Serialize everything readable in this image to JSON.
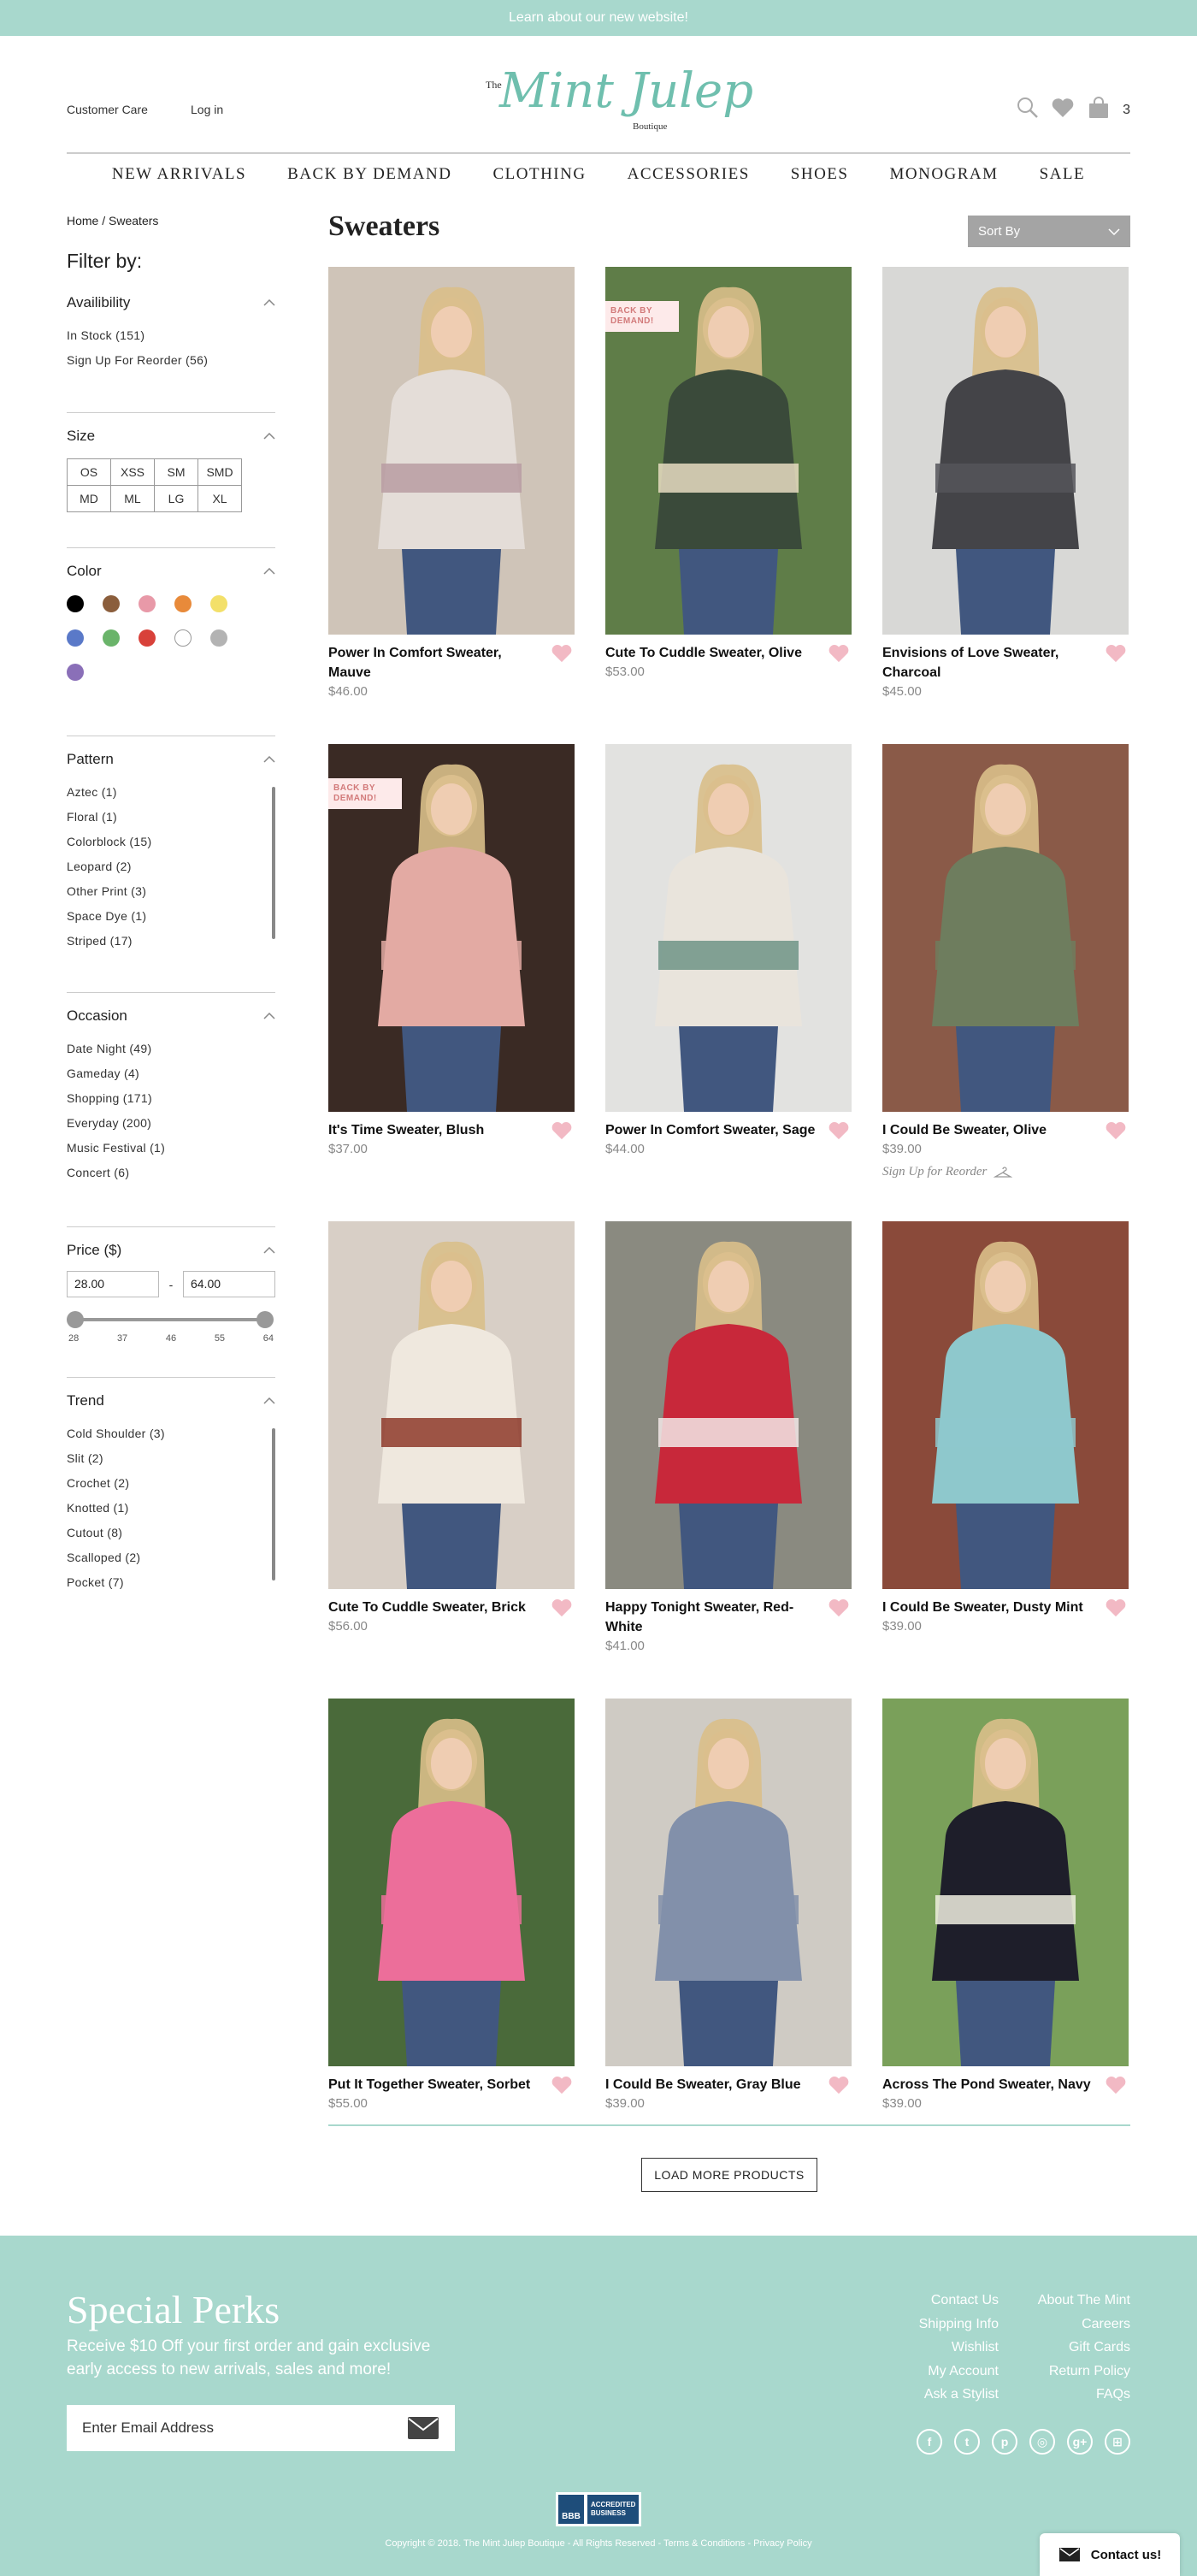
{
  "topbar": {
    "text": "Learn about our new website!"
  },
  "header": {
    "customer_care": "Customer Care",
    "login": "Log in",
    "logo": {
      "the": "The",
      "name": "Mint Julep",
      "boutique": "Boutique"
    },
    "cart_count": "3",
    "icons": [
      "search-icon",
      "heart-icon",
      "bag-icon"
    ]
  },
  "nav": [
    "NEW ARRIVALS",
    "BACK BY DEMAND",
    "CLOTHING",
    "ACCESSORIES",
    "SHOES",
    "MONOGRAM",
    "SALE"
  ],
  "breadcrumb": {
    "home": "Home",
    "sep": "/",
    "current": "Sweaters"
  },
  "filters": {
    "title": "Filter by:",
    "availability": {
      "label": "Availibility",
      "options": [
        "In Stock (151)",
        "Sign Up For Reorder (56)"
      ]
    },
    "size": {
      "label": "Size",
      "options": [
        "OS",
        "XSS",
        "SM",
        "SMD",
        "MD",
        "ML",
        "LG",
        "XL"
      ]
    },
    "color": {
      "label": "Color",
      "swatches": [
        "#000000",
        "#8b5e3c",
        "#e899a8",
        "#e88a3a",
        "#f3e06a",
        "#5a79c8",
        "#6ab46a",
        "#d8413a",
        "#ffffff",
        "#b3b3b3",
        "#8a6fb8"
      ]
    },
    "pattern": {
      "label": "Pattern",
      "options": [
        "Aztec (1)",
        "Floral (1)",
        "Colorblock (15)",
        "Leopard (2)",
        "Other Print (3)",
        "Space Dye (1)",
        "Striped (17)"
      ]
    },
    "occasion": {
      "label": "Occasion",
      "options": [
        "Date Night (49)",
        "Gameday (4)",
        "Shopping (171)",
        "Everyday (200)",
        "Music Festival (1)",
        "Concert (6)"
      ]
    },
    "price": {
      "label": "Price ($)",
      "min": "28.00",
      "sep": "-",
      "max": "64.00",
      "ticks": [
        "28",
        "37",
        "46",
        "55",
        "64"
      ]
    },
    "trend": {
      "label": "Trend",
      "options": [
        "Cold Shoulder (3)",
        "Slit (2)",
        "Crochet (2)",
        "Knotted (1)",
        "Cutout (8)",
        "Scalloped (2)",
        "Pocket (7)"
      ]
    }
  },
  "page": {
    "title": "Sweaters",
    "sort_label": "Sort By"
  },
  "badge_text": "BACK BY DEMAND!",
  "reorder_text": "Sign Up for Reorder",
  "products": [
    {
      "name": "Power In Comfort Sweater, Mauve",
      "price": "$46.00",
      "bg": "#cfc4b8",
      "top": "#e4ddd8",
      "stripe": "#b89ca2",
      "badge": false
    },
    {
      "name": "Cute To Cuddle Sweater, Olive",
      "price": "$53.00",
      "bg": "#5f7d48",
      "top": "#3a4a3a",
      "stripe": "#e8dcc2",
      "badge": true
    },
    {
      "name": "Envisions of Love Sweater, Charcoal",
      "price": "$45.00",
      "bg": "#d8d8d6",
      "top": "#444448",
      "stripe": "#55555a",
      "badge": false
    },
    {
      "name": "It's Time Sweater, Blush",
      "price": "$37.00",
      "bg": "#3a2a24",
      "top": "#e3aaa3",
      "stripe": "#e3aaa3",
      "badge": true
    },
    {
      "name": "Power In Comfort Sweater, Sage",
      "price": "$44.00",
      "bg": "#e2e2e0",
      "top": "#e9e4dc",
      "stripe": "#6e9486",
      "badge": false
    },
    {
      "name": "I Could Be Sweater, Olive",
      "price": "$39.00",
      "bg": "#8a5a48",
      "top": "#6e7d5e",
      "stripe": "#6e7d5e",
      "badge": false,
      "reorder": true
    },
    {
      "name": "Cute To Cuddle Sweater, Brick",
      "price": "$56.00",
      "bg": "#d8cfc6",
      "top": "#efe8de",
      "stripe": "#8e3a2a",
      "badge": false
    },
    {
      "name": "Happy Tonight Sweater, Red-White",
      "price": "$41.00",
      "bg": "#8a8a80",
      "top": "#c8283a",
      "stripe": "#f2e8e8",
      "badge": false
    },
    {
      "name": "I Could Be Sweater, Dusty Mint",
      "price": "$39.00",
      "bg": "#8a4a3a",
      "top": "#8ec8cc",
      "stripe": "#8ec8cc",
      "badge": false
    },
    {
      "name": "Put It Together Sweater, Sorbet",
      "price": "$55.00",
      "bg": "#4a6a3a",
      "top": "#ec6e9a",
      "stripe": "#ec6e9a",
      "badge": false
    },
    {
      "name": "I Could Be Sweater, Gray Blue",
      "price": "$39.00",
      "bg": "#cfcbc4",
      "top": "#8290aa",
      "stripe": "#8290aa",
      "badge": false
    },
    {
      "name": "Across The Pond Sweater, Navy",
      "price": "$39.00",
      "bg": "#7aa05a",
      "top": "#1e1e2a",
      "stripe": "#f0eee0",
      "badge": false
    }
  ],
  "load_more": "LOAD MORE PRODUCTS",
  "footer": {
    "title": "Special Perks",
    "subtitle": "Receive $10 Off your first order and gain exclusive early access to new arrivals, sales and more!",
    "email_placeholder": "Enter Email Address",
    "col1": [
      "Contact Us",
      "Shipping Info",
      "Wishlist",
      "My Account",
      "Ask a Stylist"
    ],
    "col2": [
      "About The Mint",
      "Careers",
      "Gift Cards",
      "Return Policy",
      "FAQs"
    ],
    "social": [
      "f",
      "t",
      "p",
      "◎",
      "g+",
      "⊞"
    ],
    "bbb": {
      "line1": "ACCREDITED",
      "line2": "BUSINESS",
      "mark": "BBB"
    },
    "copyright": "Copyright © 2018. The Mint Julep Boutique - All Rights Reserved - Terms & Conditions - Privacy Policy",
    "contact": "Contact us!"
  }
}
